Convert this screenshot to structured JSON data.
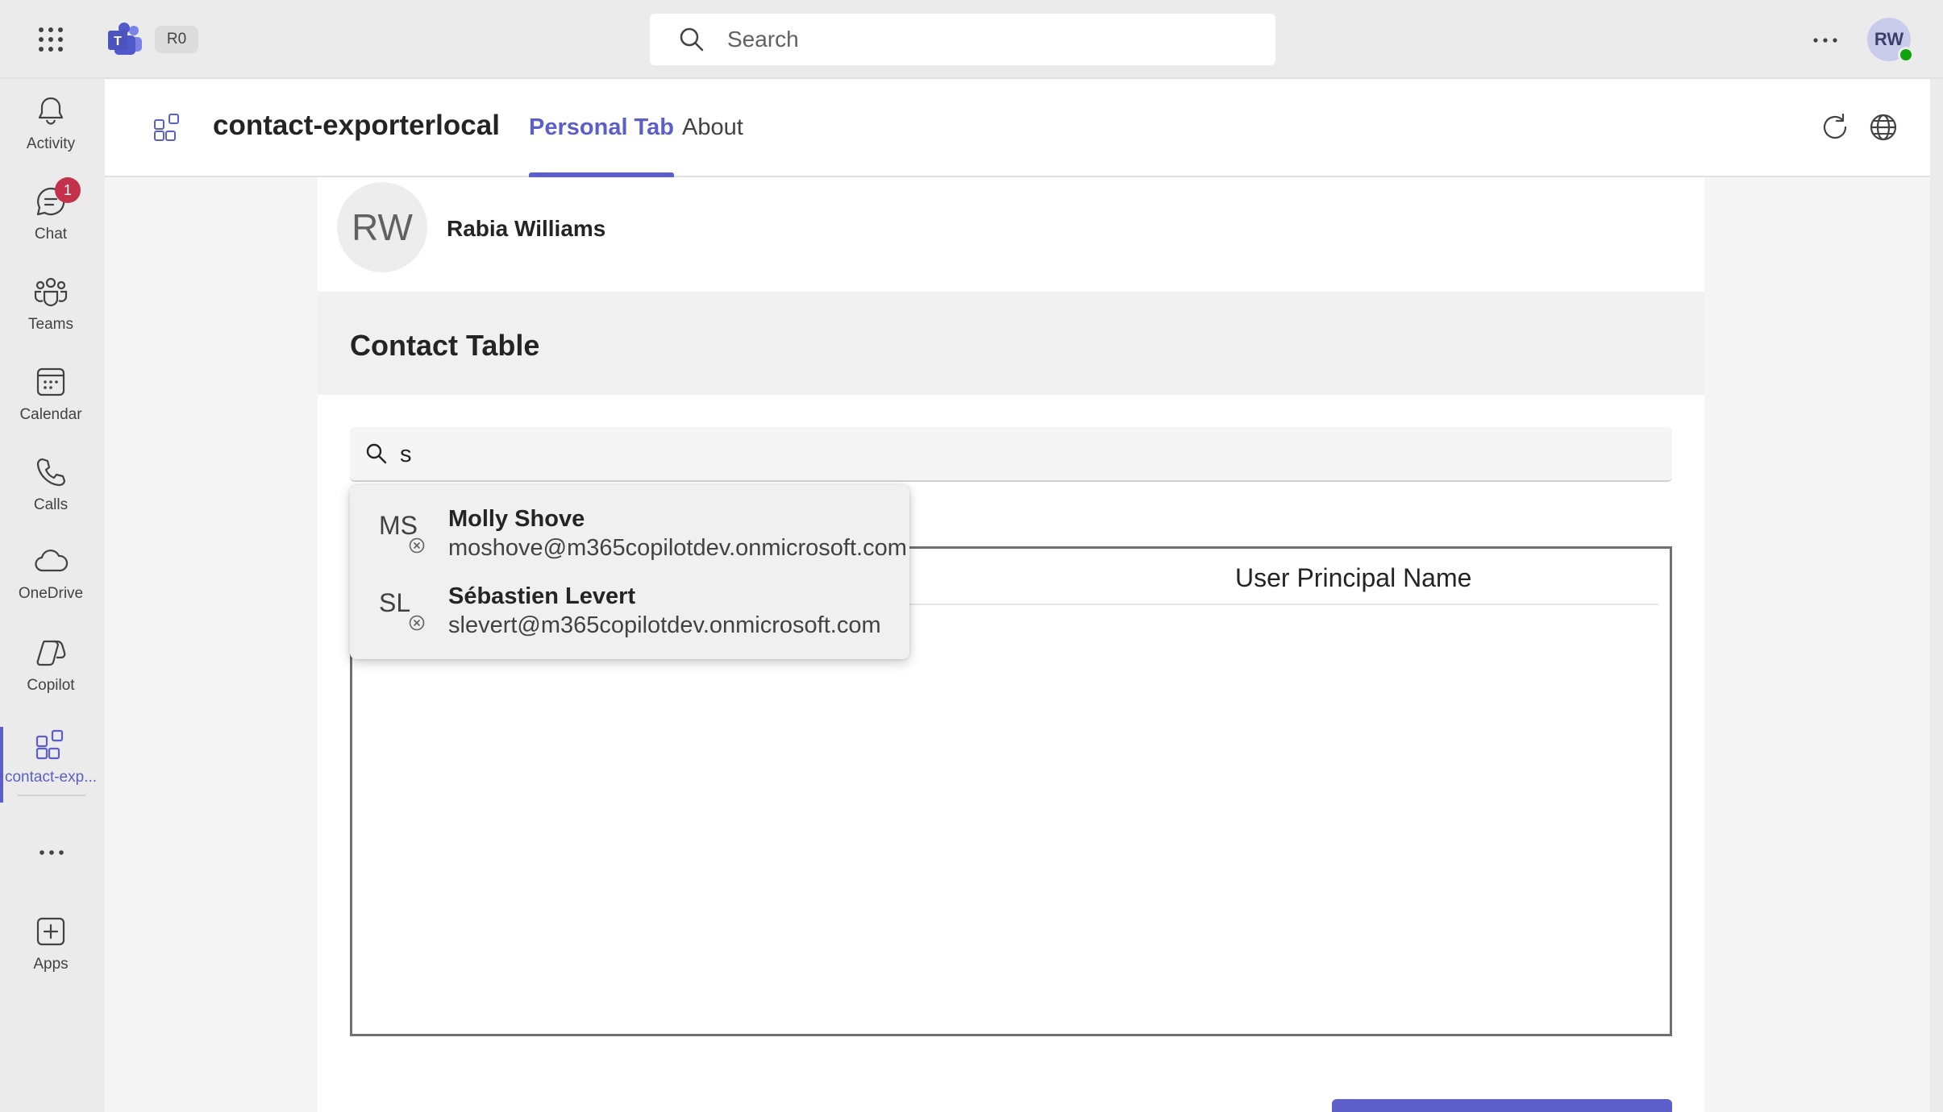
{
  "topbar": {
    "org_badge": "R0",
    "search_placeholder": "Search",
    "user_initials": "RW"
  },
  "rail": {
    "items": [
      {
        "label": "Activity",
        "icon": "bell-icon"
      },
      {
        "label": "Chat",
        "icon": "chat-icon",
        "badge": "1"
      },
      {
        "label": "Teams",
        "icon": "teams-icon"
      },
      {
        "label": "Calendar",
        "icon": "calendar-icon"
      },
      {
        "label": "Calls",
        "icon": "phone-icon"
      },
      {
        "label": "OneDrive",
        "icon": "cloud-icon"
      },
      {
        "label": "Copilot",
        "icon": "copilot-icon"
      },
      {
        "label": "contact-exp...",
        "icon": "app-grid-icon",
        "active": true
      },
      {
        "label": "Apps",
        "icon": "add-app-icon"
      }
    ]
  },
  "app": {
    "title": "contact-exporterlocal",
    "tabs": [
      {
        "label": "Personal Tab",
        "active": true
      },
      {
        "label": "About",
        "active": false
      }
    ]
  },
  "profile": {
    "initials": "RW",
    "name": "Rabia Williams"
  },
  "contact_table": {
    "heading": "Contact Table",
    "search_value": "s",
    "columns": [
      "User Principal Name"
    ]
  },
  "suggestions": [
    {
      "initials": "MS",
      "name": "Molly Shove",
      "email": "moshove@m365copilotdev.onmicrosoft.com"
    },
    {
      "initials": "SL",
      "name": "Sébastien Levert",
      "email": "slevert@m365copilotdev.onmicrosoft.com"
    }
  ],
  "colors": {
    "accent": "#5b5fc7",
    "badge": "#c4314b",
    "presence": "#13a10e"
  }
}
